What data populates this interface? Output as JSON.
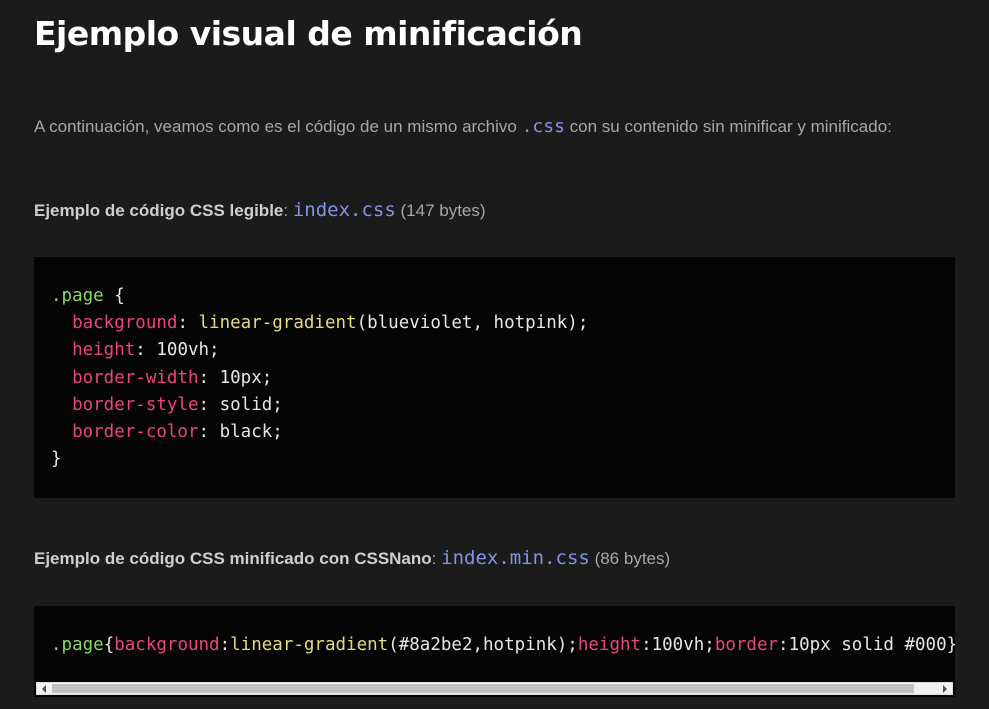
{
  "heading": "Ejemplo visual de minificación",
  "intro": {
    "before": "A continuación, veamos como es el código de un mismo archivo ",
    "code": ".css",
    "after": " con su contenido sin minificar y minificado:"
  },
  "example1": {
    "label_strong": "Ejemplo de código CSS legible",
    "separator": ": ",
    "file": "index.css",
    "size": " (147 bytes)",
    "code": {
      "selector": ".page",
      "open": " {",
      "declarations": [
        {
          "prop": "background",
          "colon": ": ",
          "fn": "linear-gradient",
          "args": "(blueviolet, hotpink);"
        },
        {
          "prop": "height",
          "colon": ": ",
          "value": "100vh;"
        },
        {
          "prop": "border-width",
          "colon": ": ",
          "value": "10px;"
        },
        {
          "prop": "border-style",
          "colon": ": ",
          "value": "solid;"
        },
        {
          "prop": "border-color",
          "colon": ": ",
          "value": "black;"
        }
      ],
      "close": "}"
    }
  },
  "example2": {
    "label_strong": "Ejemplo de código CSS minificado con CSSNano",
    "separator": ": ",
    "file": "index.min.css",
    "size": " (86 bytes)",
    "code": {
      "selector": ".page",
      "brace": "{",
      "prop1": "background",
      "colon1": ":",
      "fn": "linear-gradient",
      "args": "(#8a2be2,hotpink);",
      "prop2": "height",
      "rest2": ":100vh;",
      "prop3": "border",
      "rest3": ":10px solid #000}"
    }
  },
  "colors": {
    "background": "#1b1b1b",
    "code_background": "#050505",
    "selector": "#8bd66b",
    "property": "#ec4577",
    "function": "#e7db7f",
    "link": "#8294e6"
  },
  "icons": {
    "scroll_left": "triangle-left",
    "scroll_right": "triangle-right"
  }
}
